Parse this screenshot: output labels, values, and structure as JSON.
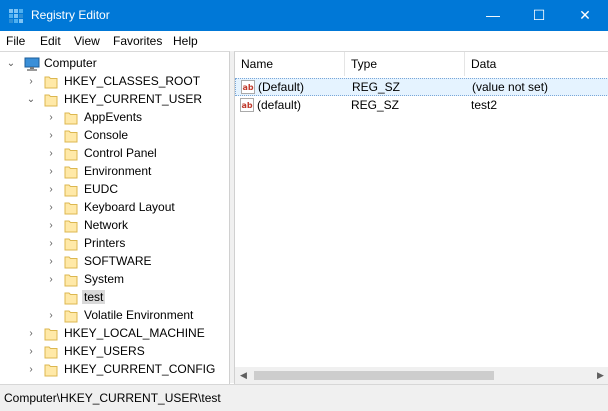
{
  "window": {
    "title": "Registry Editor",
    "min_glyph": "—",
    "max_glyph": "☐",
    "close_glyph": "✕",
    "accent": "#0078d7"
  },
  "menu": [
    "File",
    "Edit",
    "View",
    "Favorites",
    "Help"
  ],
  "tree": {
    "root": "Computer",
    "hives": [
      {
        "label": "HKEY_CLASSES_ROOT",
        "expanded": false
      },
      {
        "label": "HKEY_CURRENT_USER",
        "expanded": true,
        "children": [
          {
            "label": "AppEvents"
          },
          {
            "label": "Console"
          },
          {
            "label": "Control Panel"
          },
          {
            "label": "Environment"
          },
          {
            "label": "EUDC"
          },
          {
            "label": "Keyboard Layout"
          },
          {
            "label": "Network"
          },
          {
            "label": "Printers"
          },
          {
            "label": "SOFTWARE"
          },
          {
            "label": "System"
          },
          {
            "label": "test",
            "selected": true
          },
          {
            "label": "Volatile Environment"
          }
        ]
      },
      {
        "label": "HKEY_LOCAL_MACHINE",
        "expanded": false
      },
      {
        "label": "HKEY_USERS",
        "expanded": false
      },
      {
        "label": "HKEY_CURRENT_CONFIG",
        "expanded": false
      }
    ]
  },
  "list": {
    "columns": [
      "Name",
      "Type",
      "Data"
    ],
    "rows": [
      {
        "name": "(Default)",
        "type": "REG_SZ",
        "data": "(value not set)",
        "selected": true
      },
      {
        "name": "(default)",
        "type": "REG_SZ",
        "data": "test2",
        "selected": false
      }
    ]
  },
  "status": {
    "path": "Computer\\HKEY_CURRENT_USER\\test"
  }
}
